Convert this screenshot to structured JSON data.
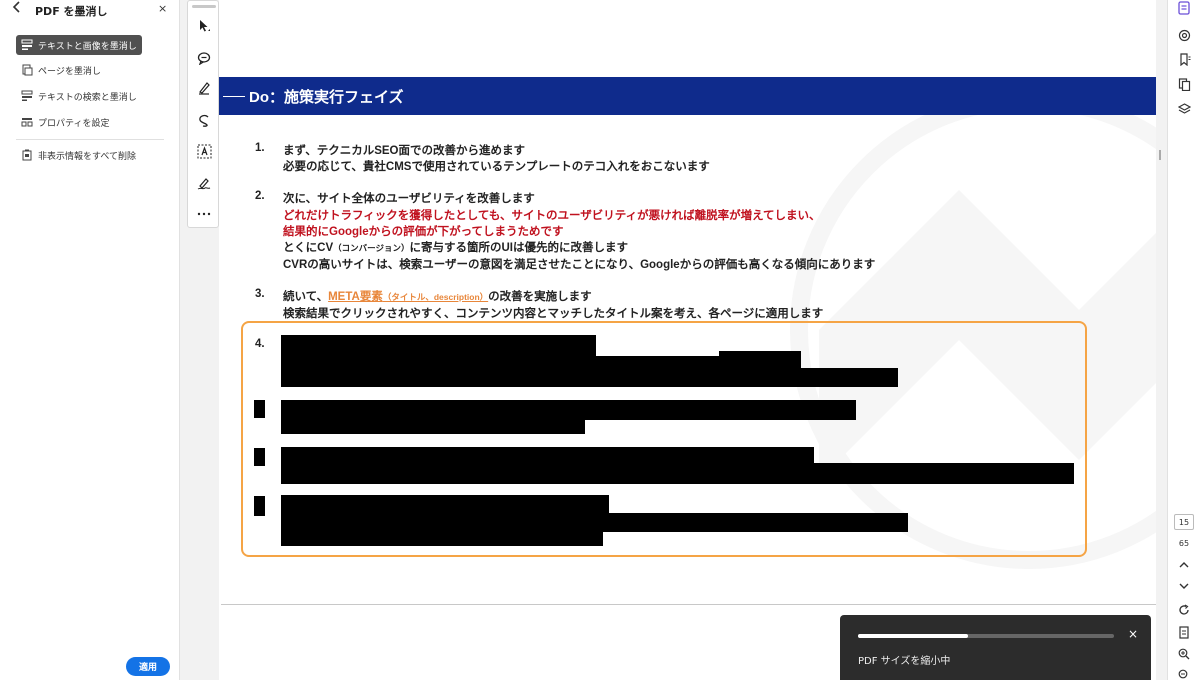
{
  "left_panel": {
    "back_icon": "chevron-left-icon",
    "title": "PDF を墨消し",
    "close_label": "×",
    "items": [
      {
        "label": "テキストと画像を墨消し",
        "icon": "redact-text-image-icon",
        "active": true
      },
      {
        "label": "ページを墨消し",
        "icon": "redact-page-icon",
        "active": false
      },
      {
        "label": "テキストの検索と墨消し",
        "icon": "find-redact-icon",
        "active": false
      },
      {
        "label": "プロパティを設定",
        "icon": "properties-icon",
        "active": false
      },
      {
        "label": "非表示情報をすべて削除",
        "icon": "remove-hidden-icon",
        "active": false
      }
    ],
    "apply_label": "適用"
  },
  "tools": [
    {
      "name": "select-tool-icon",
      "glyph": "➤"
    },
    {
      "name": "comment-tool-icon",
      "glyph": "💬"
    },
    {
      "name": "highlight-tool-icon",
      "glyph": "✎"
    },
    {
      "name": "draw-tool-icon",
      "glyph": "↺"
    },
    {
      "name": "text-box-tool-icon",
      "glyph": "A"
    },
    {
      "name": "sign-tool-icon",
      "glyph": "✍"
    },
    {
      "name": "more-tools-icon",
      "glyph": "⋯"
    }
  ],
  "document": {
    "banner_title": "Do：施策実行フェイズ",
    "item1": {
      "num": "1.",
      "line1": "まず、テクニカルSEO面での改善から進めます",
      "line2": "必要の応じて、貴社CMSで使用されているテンプレートのテコ入れをおこないます"
    },
    "item2": {
      "num": "2.",
      "line1": "次に、サイト全体のユーザビリティを改善します",
      "red1": "どれだけトラフィックを獲得したとしても、サイトのユーザビリティが悪ければ離脱率が増えてしまい、",
      "red2": "結果的にGoogleからの評価が下がってしまうためです",
      "line3_a": "とくにCV",
      "line3_small": "（コンバージョン）",
      "line3_b": "に寄与する箇所のUIは優先的に改善します",
      "line4": "CVRの高いサイトは、検索ユーザーの意図を満足させたことになり、Googleからの評価も高くなる傾向にあります"
    },
    "item3": {
      "num": "3.",
      "line1_a": "続いて、",
      "line1_link": "META要素",
      "line1_link_small": "（タイトル、description）",
      "line1_b": "の改善を実施します",
      "line2": "検索結果でクリックされやすく、コンテンツ内容とマッチしたタイトル案を考え、各ページに適用します"
    },
    "item4": {
      "num": "4."
    },
    "redaction_border_color": "#f5a445"
  },
  "right_bar": {
    "icons": [
      "ai-assistant-icon",
      "comments-panel-icon",
      "bookmarks-icon",
      "pages-panel-icon",
      "layers-icon"
    ],
    "current_page": "15",
    "total_pages": "65",
    "bottom_icons": [
      "chevron-up-icon",
      "chevron-down-icon",
      "refresh-icon",
      "page-save-icon",
      "zoom-in-icon",
      "zoom-out-icon"
    ]
  },
  "toast": {
    "message": "PDF サイズを縮小中",
    "progress": 0.43,
    "close_label": "×"
  },
  "colors": {
    "banner": "#0f2b8c",
    "apply_button": "#1473e6",
    "red_text": "#c0121f",
    "link_orange": "#e8863a"
  }
}
